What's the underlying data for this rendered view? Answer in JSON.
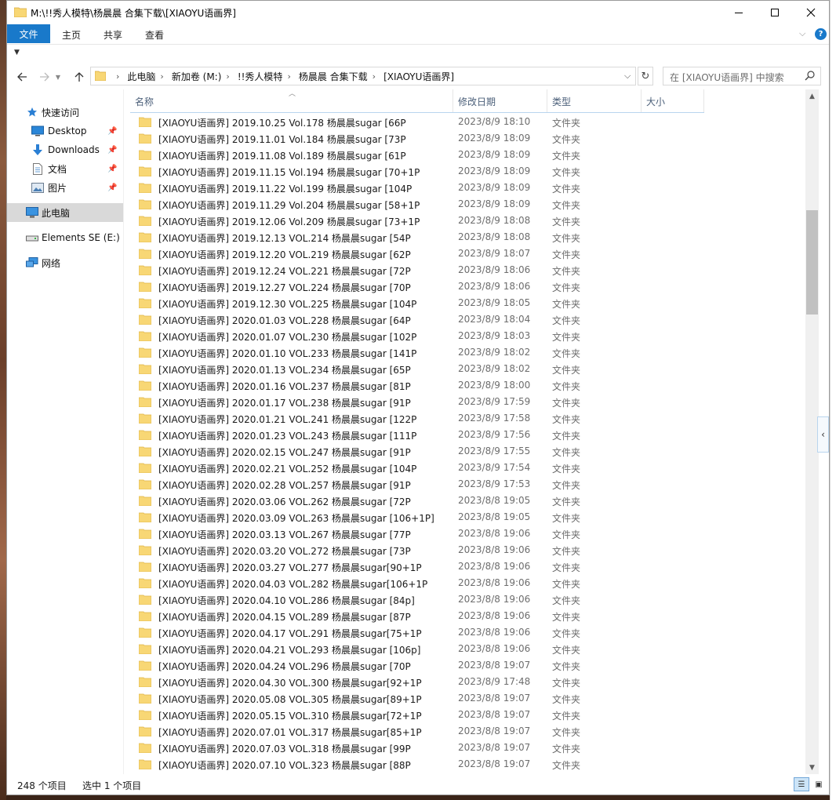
{
  "window": {
    "title": "M:\\!!秀人模特\\杨晨晨 合集下载\\[XIAOYU语画界]"
  },
  "ribbon": {
    "tabs": [
      "文件",
      "主页",
      "共享",
      "查看"
    ],
    "help": "?"
  },
  "address": {
    "crumbs": [
      "此电脑",
      "新加卷 (M:)",
      "!!秀人模特",
      "杨晨晨 合集下载",
      "[XIAOYU语画界]"
    ]
  },
  "search": {
    "placeholder": "在 [XIAOYU语画界] 中搜索"
  },
  "navpane": {
    "items": [
      {
        "label": "快速访问",
        "icon": "star-icon"
      },
      {
        "label": "Desktop",
        "icon": "desktop-icon",
        "pinned": true
      },
      {
        "label": "Downloads",
        "icon": "download-icon",
        "pinned": true
      },
      {
        "label": "文档",
        "icon": "document-icon",
        "pinned": true
      },
      {
        "label": "图片",
        "icon": "picture-icon",
        "pinned": true
      },
      {
        "label": "此电脑",
        "icon": "computer-icon",
        "selected": true
      },
      {
        "label": "Elements SE (E:)",
        "icon": "drive-icon"
      },
      {
        "label": "网络",
        "icon": "network-icon"
      }
    ]
  },
  "columns": [
    "名称",
    "修改日期",
    "类型",
    "大小"
  ],
  "files": [
    {
      "name": "[XIAOYU语画界] 2019.10.25 Vol.178 杨晨晨sugar [66P",
      "date": "2023/8/9 18:10",
      "type": "文件夹"
    },
    {
      "name": "[XIAOYU语画界] 2019.11.01 Vol.184 杨晨晨sugar [73P",
      "date": "2023/8/9 18:09",
      "type": "文件夹"
    },
    {
      "name": "[XIAOYU语画界] 2019.11.08 Vol.189 杨晨晨sugar [61P",
      "date": "2023/8/9 18:09",
      "type": "文件夹"
    },
    {
      "name": "[XIAOYU语画界] 2019.11.15 Vol.194 杨晨晨sugar [70+1P",
      "date": "2023/8/9 18:09",
      "type": "文件夹"
    },
    {
      "name": "[XIAOYU语画界] 2019.11.22 Vol.199 杨晨晨sugar [104P",
      "date": "2023/8/9 18:09",
      "type": "文件夹"
    },
    {
      "name": "[XIAOYU语画界] 2019.11.29 Vol.204 杨晨晨sugar [58+1P",
      "date": "2023/8/9 18:09",
      "type": "文件夹"
    },
    {
      "name": "[XIAOYU语画界] 2019.12.06 Vol.209 杨晨晨sugar [73+1P",
      "date": "2023/8/9 18:08",
      "type": "文件夹"
    },
    {
      "name": "[XIAOYU语画界] 2019.12.13 VOL.214 杨晨晨sugar [54P",
      "date": "2023/8/9 18:08",
      "type": "文件夹"
    },
    {
      "name": "[XIAOYU语画界] 2019.12.20 VOL.219 杨晨晨sugar [62P",
      "date": "2023/8/9 18:07",
      "type": "文件夹"
    },
    {
      "name": "[XIAOYU语画界] 2019.12.24 VOL.221 杨晨晨sugar [72P",
      "date": "2023/8/9 18:06",
      "type": "文件夹"
    },
    {
      "name": "[XIAOYU语画界] 2019.12.27 VOL.224 杨晨晨sugar [70P",
      "date": "2023/8/9 18:06",
      "type": "文件夹"
    },
    {
      "name": "[XIAOYU语画界] 2019.12.30 VOL.225 杨晨晨sugar [104P",
      "date": "2023/8/9 18:05",
      "type": "文件夹"
    },
    {
      "name": "[XIAOYU语画界] 2020.01.03 VOL.228 杨晨晨sugar [64P",
      "date": "2023/8/9 18:04",
      "type": "文件夹"
    },
    {
      "name": "[XIAOYU语画界] 2020.01.07 VOL.230 杨晨晨sugar [102P",
      "date": "2023/8/9 18:03",
      "type": "文件夹"
    },
    {
      "name": "[XIAOYU语画界] 2020.01.10 VOL.233 杨晨晨sugar [141P",
      "date": "2023/8/9 18:02",
      "type": "文件夹"
    },
    {
      "name": "[XIAOYU语画界] 2020.01.13 VOL.234 杨晨晨sugar [65P",
      "date": "2023/8/9 18:02",
      "type": "文件夹"
    },
    {
      "name": "[XIAOYU语画界] 2020.01.16 VOL.237 杨晨晨sugar [81P",
      "date": "2023/8/9 18:00",
      "type": "文件夹"
    },
    {
      "name": "[XIAOYU语画界] 2020.01.17 VOL.238 杨晨晨sugar [91P",
      "date": "2023/8/9 17:59",
      "type": "文件夹"
    },
    {
      "name": "[XIAOYU语画界] 2020.01.21 VOL.241 杨晨晨sugar [122P",
      "date": "2023/8/9 17:58",
      "type": "文件夹"
    },
    {
      "name": "[XIAOYU语画界] 2020.01.23 VOL.243 杨晨晨sugar [111P",
      "date": "2023/8/9 17:56",
      "type": "文件夹"
    },
    {
      "name": "[XIAOYU语画界] 2020.02.15 VOL.247 杨晨晨sugar [91P",
      "date": "2023/8/9 17:55",
      "type": "文件夹"
    },
    {
      "name": "[XIAOYU语画界] 2020.02.21 VOL.252 杨晨晨sugar [104P",
      "date": "2023/8/9 17:54",
      "type": "文件夹"
    },
    {
      "name": "[XIAOYU语画界] 2020.02.28 VOL.257 杨晨晨sugar [91P",
      "date": "2023/8/9 17:53",
      "type": "文件夹"
    },
    {
      "name": "[XIAOYU语画界] 2020.03.06 VOL.262 杨晨晨sugar [72P",
      "date": "2023/8/8 19:05",
      "type": "文件夹"
    },
    {
      "name": "[XIAOYU语画界] 2020.03.09 VOL.263 杨晨晨sugar [106+1P]",
      "date": "2023/8/8 19:05",
      "type": "文件夹"
    },
    {
      "name": "[XIAOYU语画界] 2020.03.13 VOL.267 杨晨晨sugar [77P",
      "date": "2023/8/8 19:06",
      "type": "文件夹"
    },
    {
      "name": "[XIAOYU语画界] 2020.03.20 VOL.272 杨晨晨sugar [73P",
      "date": "2023/8/8 19:06",
      "type": "文件夹"
    },
    {
      "name": "[XIAOYU语画界] 2020.03.27 VOL.277 杨晨晨sugar[90+1P",
      "date": "2023/8/8 19:06",
      "type": "文件夹"
    },
    {
      "name": "[XIAOYU语画界] 2020.04.03 VOL.282 杨晨晨sugar[106+1P",
      "date": "2023/8/8 19:06",
      "type": "文件夹"
    },
    {
      "name": "[XIAOYU语画界] 2020.04.10 VOL.286 杨晨晨sugar [84p]",
      "date": "2023/8/8 19:06",
      "type": "文件夹"
    },
    {
      "name": "[XIAOYU语画界] 2020.04.15 VOL.289 杨晨晨sugar [87P",
      "date": "2023/8/8 19:06",
      "type": "文件夹"
    },
    {
      "name": "[XIAOYU语画界] 2020.04.17 VOL.291 杨晨晨sugar[75+1P",
      "date": "2023/8/8 19:06",
      "type": "文件夹"
    },
    {
      "name": "[XIAOYU语画界] 2020.04.21 VOL.293 杨晨晨sugar [106p]",
      "date": "2023/8/8 19:06",
      "type": "文件夹"
    },
    {
      "name": "[XIAOYU语画界] 2020.04.24 VOL.296 杨晨晨sugar [70P",
      "date": "2023/8/8 19:07",
      "type": "文件夹"
    },
    {
      "name": "[XIAOYU语画界] 2020.04.30 VOL.300 杨晨晨sugar[92+1P",
      "date": "2023/8/9 17:48",
      "type": "文件夹"
    },
    {
      "name": "[XIAOYU语画界] 2020.05.08 VOL.305 杨晨晨sugar[89+1P",
      "date": "2023/8/8 19:07",
      "type": "文件夹"
    },
    {
      "name": "[XIAOYU语画界] 2020.05.15 VOL.310 杨晨晨sugar[72+1P",
      "date": "2023/8/8 19:07",
      "type": "文件夹"
    },
    {
      "name": "[XIAOYU语画界] 2020.07.01 VOL.317 杨晨晨sugar[85+1P",
      "date": "2023/8/8 19:07",
      "type": "文件夹"
    },
    {
      "name": "[XIAOYU语画界] 2020.07.03 VOL.318 杨晨晨sugar [99P",
      "date": "2023/8/8 19:07",
      "type": "文件夹"
    },
    {
      "name": "[XIAOYU语画界] 2020.07.10 VOL.323 杨晨晨sugar [88P",
      "date": "2023/8/8 19:07",
      "type": "文件夹"
    }
  ],
  "status": {
    "count": "248 个项目",
    "selected": "选中 1 个项目"
  },
  "colors": {
    "accent": "#1979ca",
    "folder": "#f8d775",
    "header_text": "#4c607a"
  }
}
